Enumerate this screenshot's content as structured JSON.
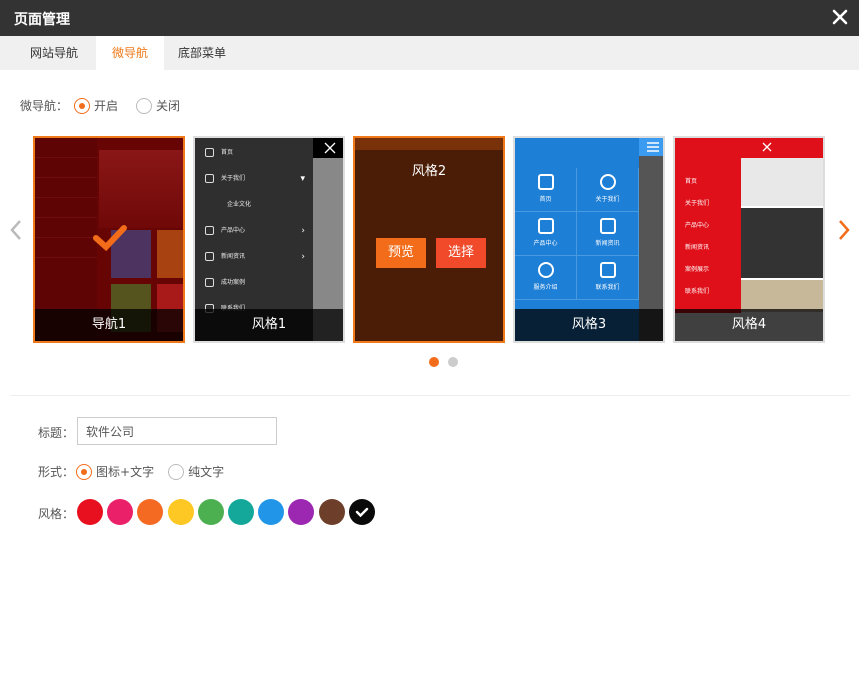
{
  "window": {
    "title": "页面管理"
  },
  "tabs": [
    {
      "label": "网站导航"
    },
    {
      "label": "微导航"
    },
    {
      "label": "底部菜单"
    }
  ],
  "micro_nav": {
    "label": "微导航：",
    "options": [
      {
        "label": "开启",
        "selected": true
      },
      {
        "label": "关闭",
        "selected": false
      }
    ]
  },
  "templates": [
    {
      "caption": "导航1",
      "selected": true
    },
    {
      "caption": "风格1"
    },
    {
      "caption": "风格2",
      "hover_title": "风格2",
      "preview_label": "预览",
      "select_label": "选择"
    },
    {
      "caption": "风格3"
    },
    {
      "caption": "风格4"
    }
  ],
  "thumb_text": {
    "t2_menu": [
      "首页",
      "关于我们",
      "企业文化",
      "产品中心",
      "新闻资讯",
      "成功案例",
      "联系我们"
    ],
    "t4_cells": [
      "首页",
      "关于我们",
      "产品中心",
      "新闻资讯",
      "服务介绍",
      "联系我们"
    ],
    "t5_menu": [
      "首页",
      "关于我们",
      "产品中心",
      "新闻资讯",
      "案例展示",
      "联系我们"
    ]
  },
  "carousel": {
    "page": 1,
    "pages": 2
  },
  "form": {
    "title_label": "标题：",
    "title_value": "软件公司",
    "style_label": "形式：",
    "style_options": [
      {
        "label": "图标+文字",
        "selected": true
      },
      {
        "label": "纯文字",
        "selected": false
      }
    ],
    "color_label": "风格：",
    "colors": [
      "#e8101e",
      "#ea2169",
      "#f46a23",
      "#fdc823",
      "#4caf50",
      "#14a89a",
      "#2196e8",
      "#9c27b0",
      "#6d3f2a",
      "#0a0a0a"
    ],
    "selected_color_index": 9
  },
  "colors": {
    "accent": "#f26c1a",
    "titlebar": "#333333"
  }
}
